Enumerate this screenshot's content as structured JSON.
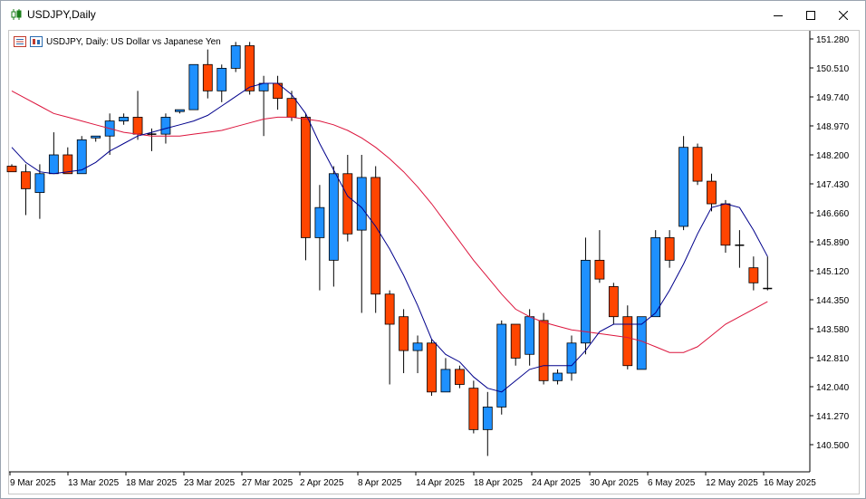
{
  "window": {
    "title": "USDJPY,Daily",
    "legend_text": "USDJPY, Daily:  US Dollar vs Japanese Yen"
  },
  "colors": {
    "bull": "#1e90ff",
    "bear": "#ff4500",
    "ma_fast": "#00008b",
    "ma_slow": "#dc143c"
  },
  "chart_data": {
    "type": "candlestick",
    "y_ticks": [
      "151.280",
      "150.510",
      "149.740",
      "148.970",
      "148.200",
      "147.430",
      "146.660",
      "145.890",
      "145.120",
      "144.350",
      "143.580",
      "142.810",
      "142.040",
      "141.270",
      "140.500"
    ],
    "x_ticks": [
      "9 Mar 2025",
      "13 Mar 2025",
      "18 Mar 2025",
      "23 Mar 2025",
      "27 Mar 2025",
      "2 Apr 2025",
      "8 Apr 2025",
      "14 Apr 2025",
      "18 Apr 2025",
      "24 Apr 2025",
      "30 Apr 2025",
      "6 May 2025",
      "12 May 2025",
      "16 May 2025"
    ],
    "ylim": [
      139.8,
      151.4
    ],
    "candles": [
      {
        "o": 147.9,
        "h": 147.95,
        "l": 147.75,
        "c": 147.75
      },
      {
        "o": 147.75,
        "h": 147.95,
        "l": 146.6,
        "c": 147.3
      },
      {
        "o": 147.2,
        "h": 147.95,
        "l": 146.5,
        "c": 147.7
      },
      {
        "o": 147.7,
        "h": 148.8,
        "l": 147.7,
        "c": 148.2
      },
      {
        "o": 148.2,
        "h": 148.4,
        "l": 147.7,
        "c": 147.7
      },
      {
        "o": 147.7,
        "h": 148.7,
        "l": 147.7,
        "c": 148.6
      },
      {
        "o": 148.65,
        "h": 148.7,
        "l": 148.55,
        "c": 148.7
      },
      {
        "o": 148.7,
        "h": 149.3,
        "l": 148.2,
        "c": 149.1
      },
      {
        "o": 149.1,
        "h": 149.3,
        "l": 149.0,
        "c": 149.2
      },
      {
        "o": 149.2,
        "h": 149.9,
        "l": 148.6,
        "c": 148.75
      },
      {
        "o": 148.75,
        "h": 148.9,
        "l": 148.3,
        "c": 148.75
      },
      {
        "o": 148.75,
        "h": 149.3,
        "l": 148.5,
        "c": 149.2
      },
      {
        "o": 149.35,
        "h": 149.4,
        "l": 149.3,
        "c": 149.4
      },
      {
        "o": 149.4,
        "h": 150.6,
        "l": 149.4,
        "c": 150.6
      },
      {
        "o": 150.6,
        "h": 151.0,
        "l": 149.7,
        "c": 149.9
      },
      {
        "o": 149.9,
        "h": 150.6,
        "l": 149.6,
        "c": 150.5
      },
      {
        "o": 150.5,
        "h": 151.2,
        "l": 150.4,
        "c": 151.1
      },
      {
        "o": 151.1,
        "h": 151.2,
        "l": 149.8,
        "c": 149.9
      },
      {
        "o": 149.9,
        "h": 150.3,
        "l": 148.7,
        "c": 150.1
      },
      {
        "o": 150.1,
        "h": 150.3,
        "l": 149.4,
        "c": 149.7
      },
      {
        "o": 149.7,
        "h": 149.9,
        "l": 149.1,
        "c": 149.2
      },
      {
        "o": 149.2,
        "h": 149.3,
        "l": 145.4,
        "c": 146.0
      },
      {
        "o": 146.0,
        "h": 147.4,
        "l": 144.6,
        "c": 146.8
      },
      {
        "o": 145.4,
        "h": 147.9,
        "l": 144.7,
        "c": 147.7
      },
      {
        "o": 147.7,
        "h": 148.2,
        "l": 145.9,
        "c": 146.1
      },
      {
        "o": 146.2,
        "h": 148.2,
        "l": 144.0,
        "c": 147.6
      },
      {
        "o": 147.6,
        "h": 147.9,
        "l": 144.0,
        "c": 144.5
      },
      {
        "o": 144.5,
        "h": 144.6,
        "l": 142.1,
        "c": 143.7
      },
      {
        "o": 143.9,
        "h": 144.1,
        "l": 142.4,
        "c": 143.0
      },
      {
        "o": 143.0,
        "h": 143.4,
        "l": 142.4,
        "c": 143.2
      },
      {
        "o": 143.2,
        "h": 143.3,
        "l": 141.8,
        "c": 141.9
      },
      {
        "o": 141.9,
        "h": 142.8,
        "l": 141.9,
        "c": 142.5
      },
      {
        "o": 142.5,
        "h": 142.6,
        "l": 142.0,
        "c": 142.1
      },
      {
        "o": 142.0,
        "h": 142.2,
        "l": 140.8,
        "c": 140.9
      },
      {
        "o": 140.9,
        "h": 141.9,
        "l": 140.2,
        "c": 141.5
      },
      {
        "o": 141.5,
        "h": 143.8,
        "l": 141.3,
        "c": 143.7
      },
      {
        "o": 143.7,
        "h": 143.7,
        "l": 142.6,
        "c": 142.8
      },
      {
        "o": 142.9,
        "h": 144.1,
        "l": 142.6,
        "c": 143.9
      },
      {
        "o": 143.8,
        "h": 144.0,
        "l": 142.1,
        "c": 142.2
      },
      {
        "o": 142.2,
        "h": 142.5,
        "l": 142.1,
        "c": 142.4
      },
      {
        "o": 142.4,
        "h": 143.4,
        "l": 142.2,
        "c": 143.2
      },
      {
        "o": 143.2,
        "h": 146.0,
        "l": 142.9,
        "c": 145.4
      },
      {
        "o": 145.4,
        "h": 146.2,
        "l": 144.8,
        "c": 144.9
      },
      {
        "o": 144.7,
        "h": 144.8,
        "l": 143.7,
        "c": 143.9
      },
      {
        "o": 143.9,
        "h": 144.2,
        "l": 142.5,
        "c": 142.6
      },
      {
        "o": 142.5,
        "h": 143.9,
        "l": 142.5,
        "c": 143.9
      },
      {
        "o": 143.9,
        "h": 146.2,
        "l": 143.9,
        "c": 146.0
      },
      {
        "o": 146.0,
        "h": 146.2,
        "l": 145.2,
        "c": 145.4
      },
      {
        "o": 146.3,
        "h": 148.7,
        "l": 146.2,
        "c": 148.4
      },
      {
        "o": 148.4,
        "h": 148.5,
        "l": 147.4,
        "c": 147.5
      },
      {
        "o": 147.5,
        "h": 147.7,
        "l": 146.7,
        "c": 146.9
      },
      {
        "o": 146.9,
        "h": 147.0,
        "l": 145.6,
        "c": 145.8
      },
      {
        "o": 145.8,
        "h": 146.2,
        "l": 145.2,
        "c": 145.8
      },
      {
        "o": 145.2,
        "h": 145.5,
        "l": 144.6,
        "c": 144.8
      },
      {
        "o": 144.65,
        "h": 145.5,
        "l": 144.6,
        "c": 144.65
      }
    ],
    "ma_fast": [
      148.4,
      148.0,
      147.75,
      147.7,
      147.75,
      147.8,
      148.0,
      148.3,
      148.5,
      148.7,
      148.8,
      148.9,
      149.0,
      149.1,
      149.25,
      149.5,
      149.75,
      150.0,
      150.1,
      150.1,
      149.8,
      149.3,
      148.5,
      147.8,
      147.1,
      146.8,
      146.3,
      145.7,
      145.0,
      144.2,
      143.3,
      142.9,
      142.7,
      142.3,
      142.0,
      141.9,
      142.2,
      142.5,
      142.6,
      142.6,
      142.6,
      143.0,
      143.5,
      143.7,
      143.7,
      143.7,
      144.0,
      144.6,
      145.3,
      146.1,
      146.8,
      146.9,
      146.8,
      146.2,
      145.5
    ],
    "ma_slow": [
      149.9,
      149.7,
      149.5,
      149.3,
      149.2,
      149.1,
      149.0,
      148.9,
      148.8,
      148.75,
      148.7,
      148.7,
      148.7,
      148.75,
      148.8,
      148.85,
      148.95,
      149.05,
      149.15,
      149.2,
      149.2,
      149.15,
      149.1,
      149.0,
      148.85,
      148.65,
      148.4,
      148.1,
      147.75,
      147.35,
      146.9,
      146.4,
      145.9,
      145.4,
      144.95,
      144.5,
      144.1,
      143.9,
      143.75,
      143.65,
      143.55,
      143.5,
      143.45,
      143.4,
      143.35,
      143.25,
      143.1,
      142.95,
      142.95,
      143.1,
      143.4,
      143.7,
      143.9,
      144.1,
      144.3
    ],
    "grid": false,
    "legend": "top-left"
  }
}
